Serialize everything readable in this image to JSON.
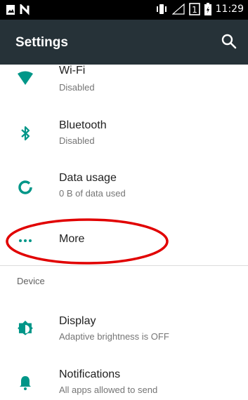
{
  "status_bar": {
    "time": "11:29",
    "icons": [
      "image-icon",
      "n-icon",
      "vibrate-icon",
      "signal-icon",
      "sim-icon",
      "battery-icon"
    ]
  },
  "toolbar": {
    "title": "Settings",
    "search_icon": "search-icon"
  },
  "items": [
    {
      "title": "Wi-Fi",
      "subtitle": "Disabled",
      "icon": "wifi-icon"
    },
    {
      "title": "Bluetooth",
      "subtitle": "Disabled",
      "icon": "bluetooth-icon"
    },
    {
      "title": "Data usage",
      "subtitle": "0 B of data used",
      "icon": "data-usage-icon"
    },
    {
      "title": "More",
      "icon": "more-icon"
    }
  ],
  "section_device": "Device",
  "device_items": [
    {
      "title": "Display",
      "subtitle": "Adaptive brightness is OFF",
      "icon": "display-icon"
    },
    {
      "title": "Notifications",
      "subtitle": "All apps allowed to send",
      "icon": "bell-icon"
    }
  ],
  "colors": {
    "accent": "#009688",
    "toolbar": "#263238",
    "annotation": "#e10000"
  }
}
